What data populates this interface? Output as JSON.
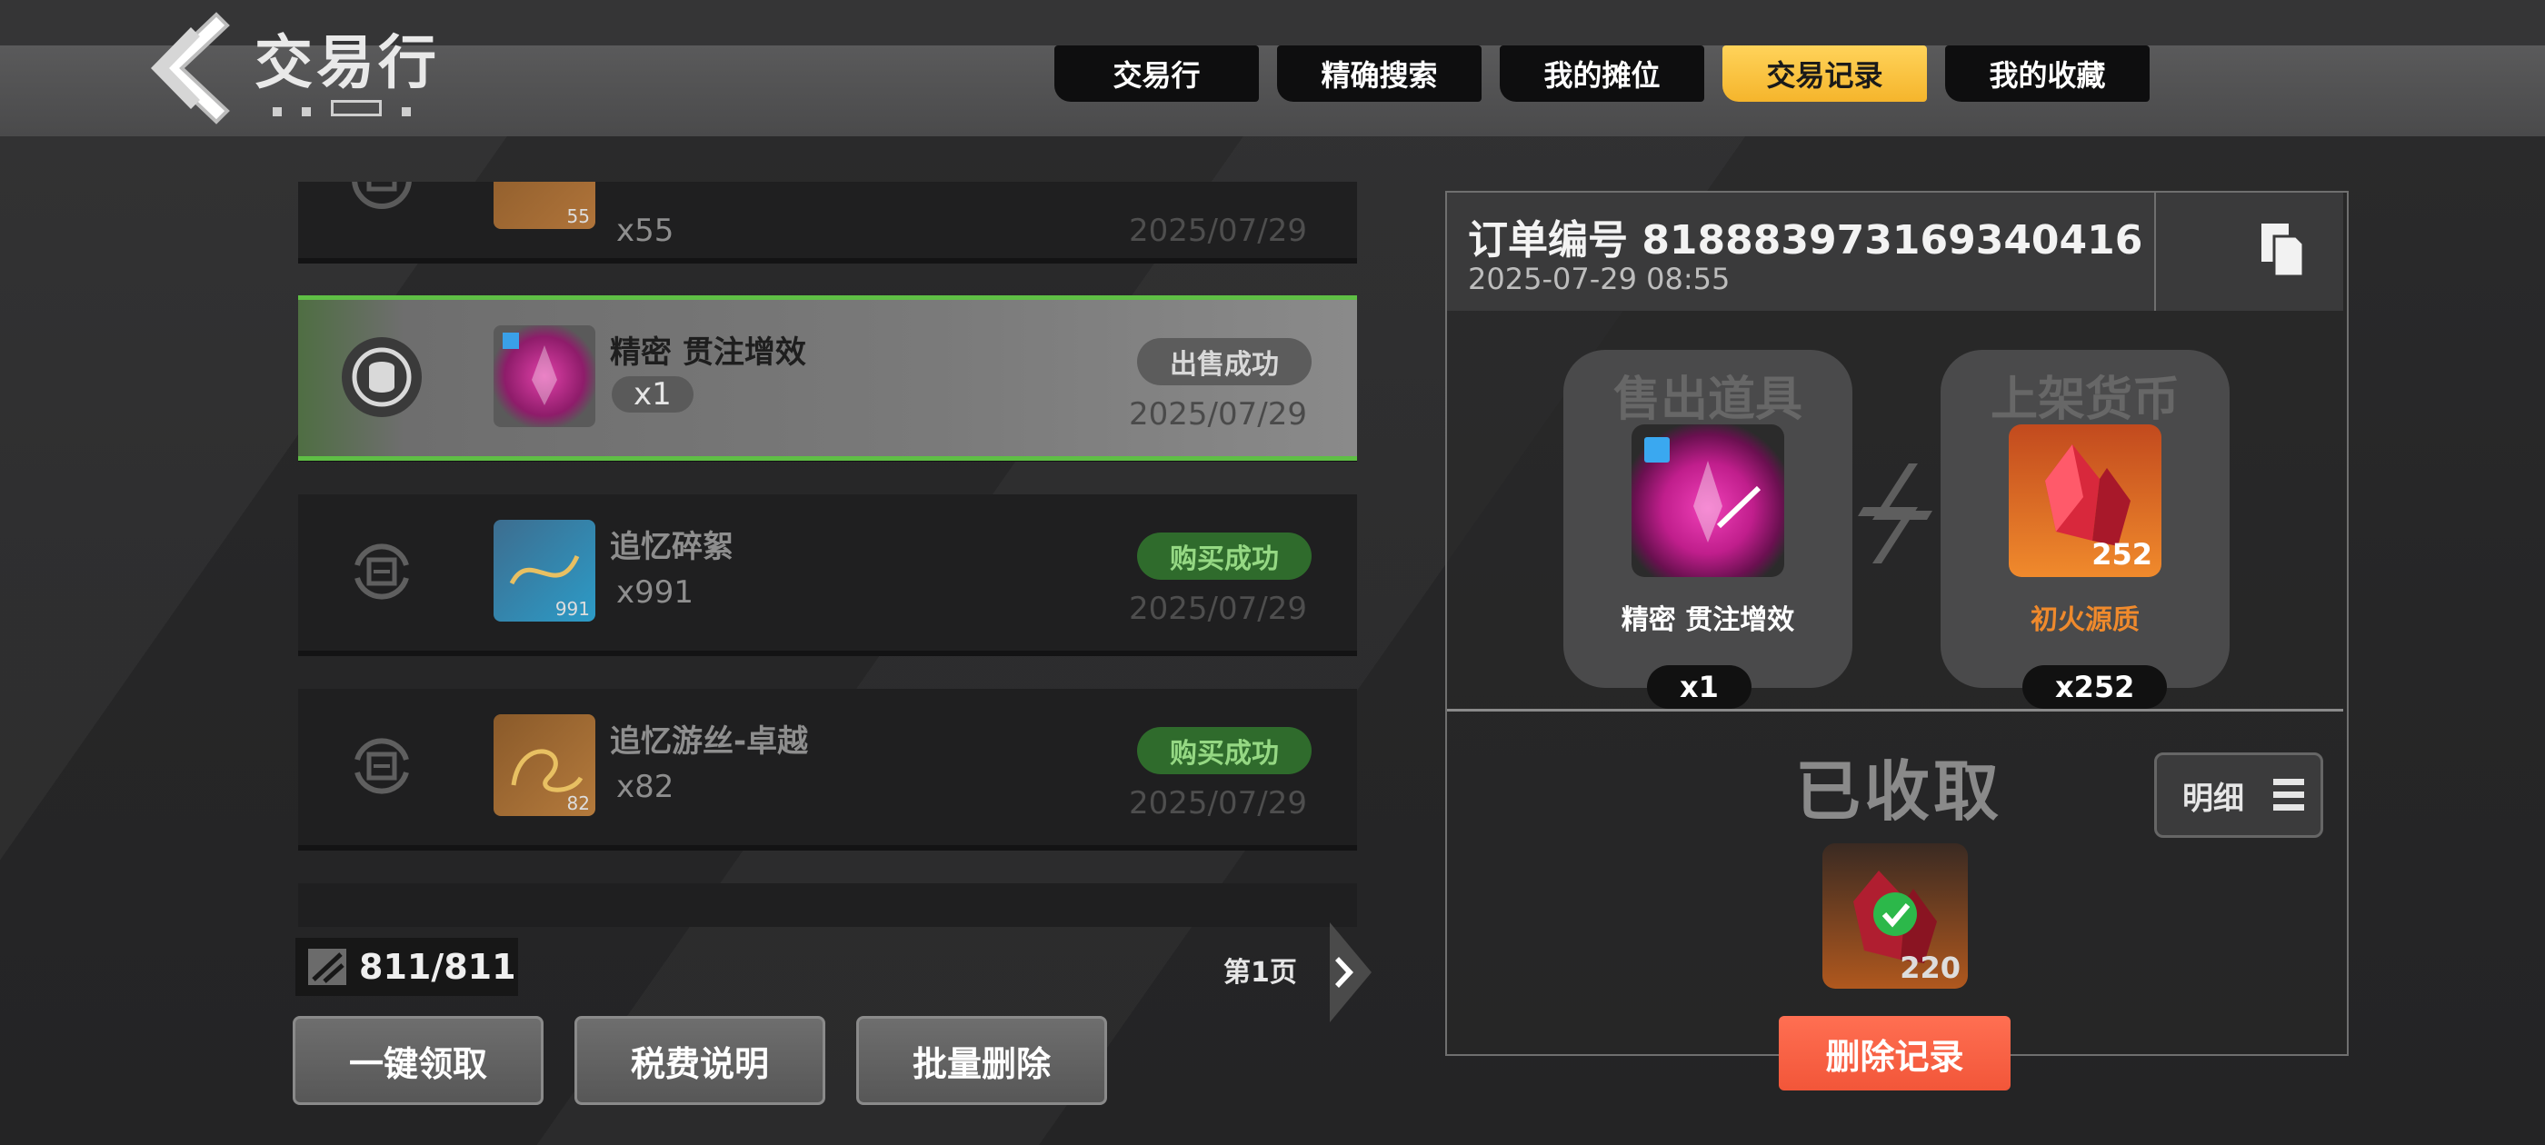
{
  "header": {
    "title": "交易行",
    "tabs": [
      "交易行",
      "精确搜索",
      "我的摊位",
      "交易记录",
      "我的收藏"
    ],
    "active_tab": "交易记录"
  },
  "records": [
    {
      "name": "",
      "qty": "x55",
      "count": "55",
      "status": "",
      "date": "2025/07/29",
      "selected": false
    },
    {
      "name": "精密 贯注增效",
      "qty": "x1",
      "count": "",
      "status": "出售成功",
      "date": "2025/07/29",
      "selected": true
    },
    {
      "name": "追忆碎絮",
      "qty": "x991",
      "count": "991",
      "status": "购买成功",
      "date": "2025/07/29",
      "selected": false
    },
    {
      "name": "追忆游丝-卓越",
      "qty": "x82",
      "count": "82",
      "status": "购买成功",
      "date": "2025/07/29",
      "selected": false
    }
  ],
  "footer": {
    "count": "811/811",
    "page": "第1页",
    "buttons": [
      "一键领取",
      "税费说明",
      "批量删除"
    ]
  },
  "detail": {
    "order_label": "订单编号 818883973169340416",
    "time": "2025-07-29 08:55",
    "sold_label": "售出道具",
    "currency_label": "上架货币",
    "sold_item": {
      "name": "精密 贯注增效",
      "qty": "x1"
    },
    "currency_item": {
      "name": "初火源质",
      "qty": "x252",
      "count": "252"
    },
    "received_label": "已收取",
    "detail_button": "明细",
    "reward_count": "220",
    "delete_button": "删除记录"
  },
  "colors": {
    "tab_active": "#f7bf35",
    "success_green": "#2f6b2c",
    "delete_red": "#f25639",
    "currency_name": "#f08a2c"
  }
}
